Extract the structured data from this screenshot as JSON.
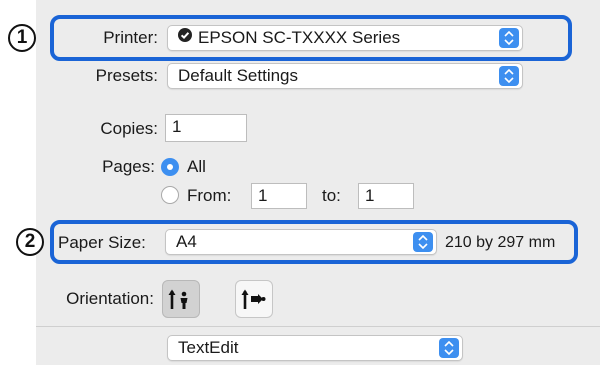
{
  "callouts": {
    "first": "1",
    "second": "2"
  },
  "printer": {
    "label": "Printer:",
    "value": "EPSON SC-TXXXX Series"
  },
  "presets": {
    "label": "Presets:",
    "value": "Default Settings"
  },
  "copies": {
    "label": "Copies:",
    "value": "1"
  },
  "pages": {
    "label": "Pages:",
    "all_label": "All",
    "from_label": "From:",
    "from_value": "1",
    "to_label": "to:",
    "to_value": "1",
    "selected": "All"
  },
  "paper_size": {
    "label": "Paper Size:",
    "value": "A4",
    "dimensions": "210 by 297 mm"
  },
  "orientation": {
    "label": "Orientation:",
    "selected": "portrait"
  },
  "app_menu": {
    "value": "TextEdit"
  },
  "colors": {
    "accent": "#3d8ff0",
    "highlight": "#1a64d6",
    "panel": "#ececec"
  },
  "icons": {
    "printer_status": "printer-status-icon",
    "stepper": "up-down-chevron-icon",
    "portrait": "portrait-orientation-icon",
    "landscape": "landscape-orientation-icon"
  }
}
